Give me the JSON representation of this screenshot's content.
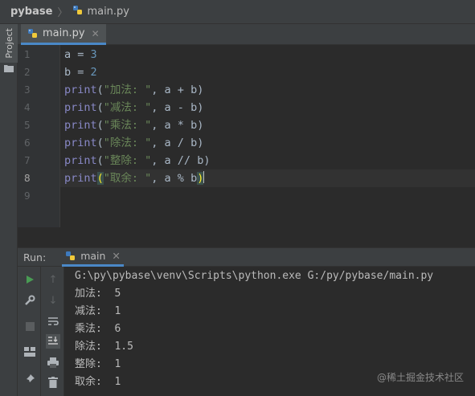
{
  "breadcrumb": {
    "project": "pybase",
    "file": "main.py"
  },
  "left_strip": {
    "project_tab": "Project"
  },
  "editor_tab": {
    "label": "main.py"
  },
  "editor": {
    "line_numbers": [
      "1",
      "2",
      "3",
      "4",
      "5",
      "6",
      "7",
      "8",
      "9"
    ],
    "lines": [
      {
        "var": "a",
        "eq": " = ",
        "num": "3"
      },
      {
        "var": "b",
        "eq": " = ",
        "num": "2"
      },
      {
        "fn": "print",
        "open": "(",
        "str": "\"加法: \"",
        "rest": ", a + b",
        "close": ")"
      },
      {
        "fn": "print",
        "open": "(",
        "str": "\"减法: \"",
        "rest": ", a - b",
        "close": ")"
      },
      {
        "fn": "print",
        "open": "(",
        "str": "\"乘法: \"",
        "rest": ", a * b",
        "close": ")"
      },
      {
        "fn": "print",
        "open": "(",
        "str": "\"除法: \"",
        "rest": ", a / b",
        "close": ")"
      },
      {
        "fn": "print",
        "open": "(",
        "str": "\"整除: \"",
        "rest": ", a // b",
        "close": ")"
      },
      {
        "fn": "print",
        "open": "(",
        "str": "\"取余: \"",
        "rest": ", a % b",
        "close": ")"
      }
    ]
  },
  "run_panel": {
    "label": "Run:",
    "tab": "main",
    "output": [
      "G:\\py\\pybase\\venv\\Scripts\\python.exe G:/py/pybase/main.py",
      "加法:  5",
      "减法:  1",
      "乘法:  6",
      "除法:  1.5",
      "整除:  1",
      "取余:  1"
    ]
  },
  "watermark": "@稀土掘金技术社区",
  "colors": {
    "accent": "#4a88c7",
    "run_green": "#499c54",
    "keyword": "#8888c6",
    "number": "#6897bb",
    "string": "#6a8759"
  }
}
